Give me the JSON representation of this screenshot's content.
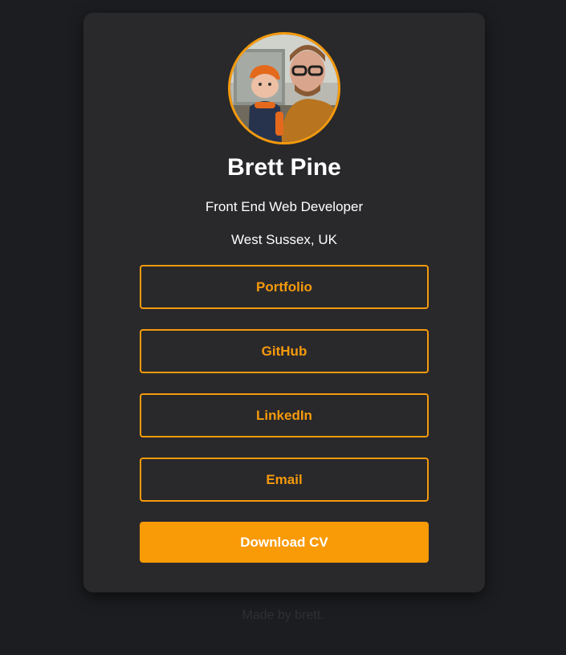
{
  "profile": {
    "name": "Brett Pine",
    "role": "Front End Web Developer",
    "location": "West Sussex, UK",
    "avatar_alt": "profile photo"
  },
  "links": {
    "portfolio": "Portfolio",
    "github": "GitHub",
    "linkedin": "LinkedIn",
    "email": "Email"
  },
  "cv_button": "Download CV",
  "footer": "Made by brett.",
  "colors": {
    "accent": "#f59a0c",
    "card": "#29292c",
    "background": "#1c1d20"
  }
}
